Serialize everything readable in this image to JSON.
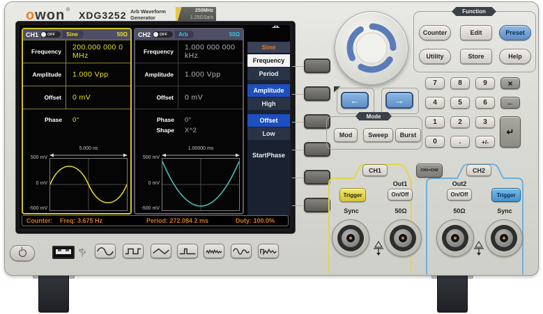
{
  "brand": {
    "logo_o": "o",
    "logo_rest": "won",
    "registered": "®",
    "model": "XDG3252",
    "subtitle_line1": "Arb Waveform",
    "subtitle_line2": "Generator",
    "badge_line1": "250MHz",
    "badge_line2": "1.25GSa/s"
  },
  "screen": {
    "ch1": {
      "name": "CH1",
      "toggle": "OFF",
      "waveform": "Sine",
      "impedance": "50Ω",
      "params": [
        {
          "label": "Frequency",
          "value": "200.000 000 0 MHz"
        },
        {
          "label": "Amplitude",
          "value": "1.000 Vpp"
        },
        {
          "label": "Offset",
          "value": "0 mV"
        },
        {
          "label": "Phase",
          "value": "0°"
        }
      ],
      "plot": {
        "span": "5.000 ns",
        "y_top": "500 mV",
        "y_mid": "0 mV",
        "y_bottom": "-500 mV",
        "wave_type": "sine"
      }
    },
    "ch2": {
      "name": "CH2",
      "toggle": "OFF",
      "waveform": "Arb",
      "impedance": "50Ω",
      "params": [
        {
          "label": "Frequency",
          "value": "1.000 000 000 kHz"
        },
        {
          "label": "Amplitude",
          "value": "1.000 Vpp"
        },
        {
          "label": "Offset",
          "value": "0 mV"
        },
        {
          "label": "Phase",
          "value": "0°"
        },
        {
          "label": "Shape",
          "value": "X^2"
        }
      ],
      "plot": {
        "span": "1.00000 ms",
        "y_top": "500 mV",
        "y_mid": "0 mV",
        "y_bottom": "-500 mV",
        "wave_type": "x-squared"
      }
    },
    "menu": {
      "title": "Sine",
      "items": [
        {
          "label": "Frequency",
          "state": "selected"
        },
        {
          "label": "Period",
          "state": "normal"
        },
        {
          "label": "Amplitude",
          "state": "highlight"
        },
        {
          "label": "High",
          "state": "normal"
        },
        {
          "label": "Offset",
          "state": "highlight"
        },
        {
          "label": "Low",
          "state": "normal"
        },
        {
          "label": "StartPhase",
          "state": "normal"
        }
      ]
    },
    "status": {
      "counter_label": "Counter:",
      "freq": "Freq: 3.675 Hz",
      "period": "Period: 272.084 2 ms",
      "duty": "Duty: 100.0%"
    },
    "icons": {
      "top_right": "usb-drive-icon"
    }
  },
  "function_section": {
    "label": "Function",
    "buttons": [
      "Counter",
      "Edit",
      "Preset",
      "Utility",
      "Store",
      "Help"
    ]
  },
  "arrows": {
    "left": "←",
    "right": "→"
  },
  "mode_section": {
    "label": "Mode",
    "buttons": [
      "Mod",
      "Sweep",
      "Burst"
    ]
  },
  "keypad": {
    "digits": [
      "7",
      "8",
      "9",
      "4",
      "5",
      "6",
      "1",
      "2",
      "3",
      "0",
      ".",
      "+/-"
    ],
    "cancel": "×",
    "backspace": "←",
    "enter": "↵"
  },
  "channel_section": {
    "ch1_button": "CH1",
    "copy_button": "CH1=CH2",
    "ch2_button": "CH2",
    "out1_label": "Out1",
    "out1_onoff": "On/Off",
    "out2_label": "Out2",
    "out2_onoff": "On/Off",
    "trigger_left": "Trigger",
    "trigger_right": "Trigger",
    "bnc_labels": [
      "Sync",
      "50Ω",
      "50Ω",
      "Sync"
    ]
  },
  "bottom_bar": {
    "waveform_keys": [
      "sine",
      "square",
      "ramp",
      "pulse",
      "noise",
      "harmonic",
      "arb"
    ]
  },
  "colors": {
    "ch1_accent": "#e0d832",
    "ch2_accent": "#3cc8c8",
    "menu_highlight": "#1e4fc0",
    "status_text": "#d8781c",
    "preset_blue": "#7aa8dc",
    "trigger_yellow": "#e8dc5c",
    "trigger_blue": "#54a8e0"
  }
}
